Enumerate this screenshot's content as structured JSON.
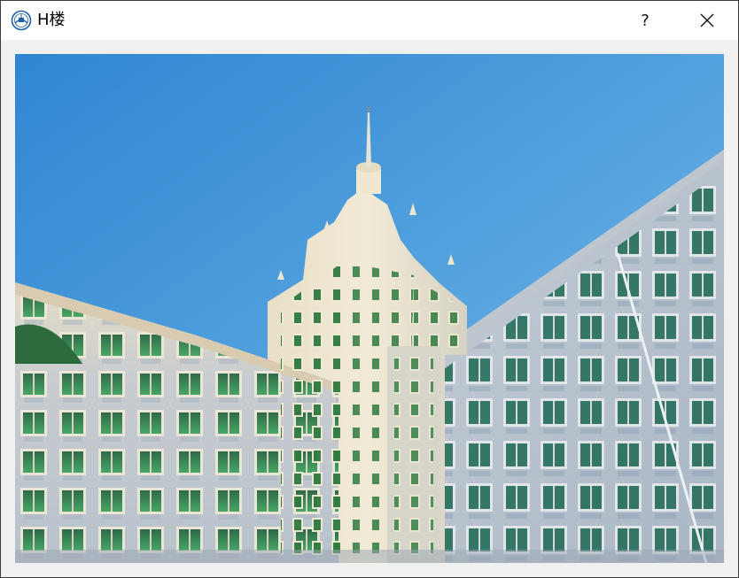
{
  "window": {
    "title": "H楼",
    "help_label": "?",
    "close_icon": "close-icon",
    "app_icon": "university-seal-icon"
  },
  "photo": {
    "subject": "building-photo",
    "sky_color": "#3f93d6",
    "wall_color": "#dcdcd6",
    "window_glass_color": "#2f8a4a"
  }
}
